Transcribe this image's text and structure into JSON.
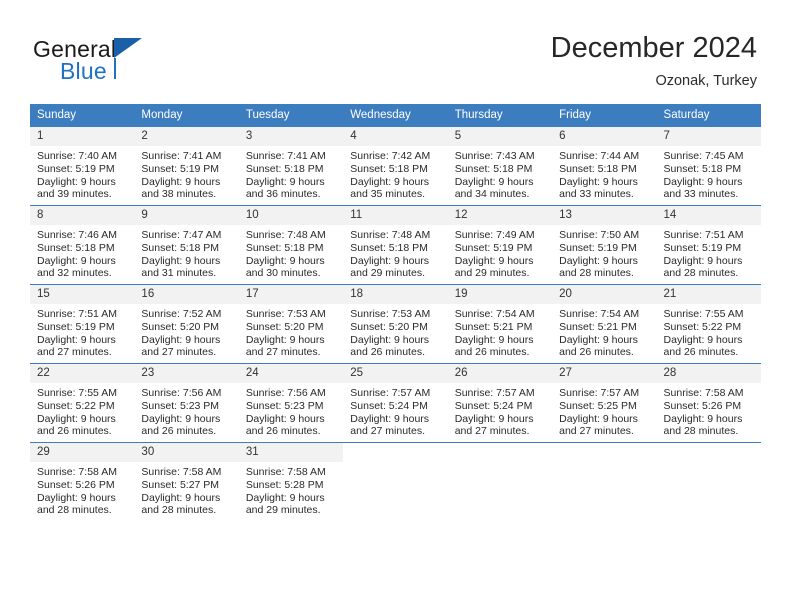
{
  "brand": {
    "name_part1": "General",
    "name_part2": "Blue",
    "triangle_color": "#1a5fa8",
    "blue_color": "#1f72c2"
  },
  "header": {
    "title": "December 2024",
    "subtitle": "Ozonak, Turkey"
  },
  "theme": {
    "header_blue": "#3c7dc0",
    "daynum_gray": "#f2f2f2",
    "text": "#2a2a2a"
  },
  "weekday_headers": [
    "Sunday",
    "Monday",
    "Tuesday",
    "Wednesday",
    "Thursday",
    "Friday",
    "Saturday"
  ],
  "weeks": [
    [
      {
        "day": "1",
        "sunrise": "Sunrise: 7:40 AM",
        "sunset": "Sunset: 5:19 PM",
        "daylight1": "Daylight: 9 hours",
        "daylight2": "and 39 minutes."
      },
      {
        "day": "2",
        "sunrise": "Sunrise: 7:41 AM",
        "sunset": "Sunset: 5:19 PM",
        "daylight1": "Daylight: 9 hours",
        "daylight2": "and 38 minutes."
      },
      {
        "day": "3",
        "sunrise": "Sunrise: 7:41 AM",
        "sunset": "Sunset: 5:18 PM",
        "daylight1": "Daylight: 9 hours",
        "daylight2": "and 36 minutes."
      },
      {
        "day": "4",
        "sunrise": "Sunrise: 7:42 AM",
        "sunset": "Sunset: 5:18 PM",
        "daylight1": "Daylight: 9 hours",
        "daylight2": "and 35 minutes."
      },
      {
        "day": "5",
        "sunrise": "Sunrise: 7:43 AM",
        "sunset": "Sunset: 5:18 PM",
        "daylight1": "Daylight: 9 hours",
        "daylight2": "and 34 minutes."
      },
      {
        "day": "6",
        "sunrise": "Sunrise: 7:44 AM",
        "sunset": "Sunset: 5:18 PM",
        "daylight1": "Daylight: 9 hours",
        "daylight2": "and 33 minutes."
      },
      {
        "day": "7",
        "sunrise": "Sunrise: 7:45 AM",
        "sunset": "Sunset: 5:18 PM",
        "daylight1": "Daylight: 9 hours",
        "daylight2": "and 33 minutes."
      }
    ],
    [
      {
        "day": "8",
        "sunrise": "Sunrise: 7:46 AM",
        "sunset": "Sunset: 5:18 PM",
        "daylight1": "Daylight: 9 hours",
        "daylight2": "and 32 minutes."
      },
      {
        "day": "9",
        "sunrise": "Sunrise: 7:47 AM",
        "sunset": "Sunset: 5:18 PM",
        "daylight1": "Daylight: 9 hours",
        "daylight2": "and 31 minutes."
      },
      {
        "day": "10",
        "sunrise": "Sunrise: 7:48 AM",
        "sunset": "Sunset: 5:18 PM",
        "daylight1": "Daylight: 9 hours",
        "daylight2": "and 30 minutes."
      },
      {
        "day": "11",
        "sunrise": "Sunrise: 7:48 AM",
        "sunset": "Sunset: 5:18 PM",
        "daylight1": "Daylight: 9 hours",
        "daylight2": "and 29 minutes."
      },
      {
        "day": "12",
        "sunrise": "Sunrise: 7:49 AM",
        "sunset": "Sunset: 5:19 PM",
        "daylight1": "Daylight: 9 hours",
        "daylight2": "and 29 minutes."
      },
      {
        "day": "13",
        "sunrise": "Sunrise: 7:50 AM",
        "sunset": "Sunset: 5:19 PM",
        "daylight1": "Daylight: 9 hours",
        "daylight2": "and 28 minutes."
      },
      {
        "day": "14",
        "sunrise": "Sunrise: 7:51 AM",
        "sunset": "Sunset: 5:19 PM",
        "daylight1": "Daylight: 9 hours",
        "daylight2": "and 28 minutes."
      }
    ],
    [
      {
        "day": "15",
        "sunrise": "Sunrise: 7:51 AM",
        "sunset": "Sunset: 5:19 PM",
        "daylight1": "Daylight: 9 hours",
        "daylight2": "and 27 minutes."
      },
      {
        "day": "16",
        "sunrise": "Sunrise: 7:52 AM",
        "sunset": "Sunset: 5:20 PM",
        "daylight1": "Daylight: 9 hours",
        "daylight2": "and 27 minutes."
      },
      {
        "day": "17",
        "sunrise": "Sunrise: 7:53 AM",
        "sunset": "Sunset: 5:20 PM",
        "daylight1": "Daylight: 9 hours",
        "daylight2": "and 27 minutes."
      },
      {
        "day": "18",
        "sunrise": "Sunrise: 7:53 AM",
        "sunset": "Sunset: 5:20 PM",
        "daylight1": "Daylight: 9 hours",
        "daylight2": "and 26 minutes."
      },
      {
        "day": "19",
        "sunrise": "Sunrise: 7:54 AM",
        "sunset": "Sunset: 5:21 PM",
        "daylight1": "Daylight: 9 hours",
        "daylight2": "and 26 minutes."
      },
      {
        "day": "20",
        "sunrise": "Sunrise: 7:54 AM",
        "sunset": "Sunset: 5:21 PM",
        "daylight1": "Daylight: 9 hours",
        "daylight2": "and 26 minutes."
      },
      {
        "day": "21",
        "sunrise": "Sunrise: 7:55 AM",
        "sunset": "Sunset: 5:22 PM",
        "daylight1": "Daylight: 9 hours",
        "daylight2": "and 26 minutes."
      }
    ],
    [
      {
        "day": "22",
        "sunrise": "Sunrise: 7:55 AM",
        "sunset": "Sunset: 5:22 PM",
        "daylight1": "Daylight: 9 hours",
        "daylight2": "and 26 minutes."
      },
      {
        "day": "23",
        "sunrise": "Sunrise: 7:56 AM",
        "sunset": "Sunset: 5:23 PM",
        "daylight1": "Daylight: 9 hours",
        "daylight2": "and 26 minutes."
      },
      {
        "day": "24",
        "sunrise": "Sunrise: 7:56 AM",
        "sunset": "Sunset: 5:23 PM",
        "daylight1": "Daylight: 9 hours",
        "daylight2": "and 26 minutes."
      },
      {
        "day": "25",
        "sunrise": "Sunrise: 7:57 AM",
        "sunset": "Sunset: 5:24 PM",
        "daylight1": "Daylight: 9 hours",
        "daylight2": "and 27 minutes."
      },
      {
        "day": "26",
        "sunrise": "Sunrise: 7:57 AM",
        "sunset": "Sunset: 5:24 PM",
        "daylight1": "Daylight: 9 hours",
        "daylight2": "and 27 minutes."
      },
      {
        "day": "27",
        "sunrise": "Sunrise: 7:57 AM",
        "sunset": "Sunset: 5:25 PM",
        "daylight1": "Daylight: 9 hours",
        "daylight2": "and 27 minutes."
      },
      {
        "day": "28",
        "sunrise": "Sunrise: 7:58 AM",
        "sunset": "Sunset: 5:26 PM",
        "daylight1": "Daylight: 9 hours",
        "daylight2": "and 28 minutes."
      }
    ],
    [
      {
        "day": "29",
        "sunrise": "Sunrise: 7:58 AM",
        "sunset": "Sunset: 5:26 PM",
        "daylight1": "Daylight: 9 hours",
        "daylight2": "and 28 minutes."
      },
      {
        "day": "30",
        "sunrise": "Sunrise: 7:58 AM",
        "sunset": "Sunset: 5:27 PM",
        "daylight1": "Daylight: 9 hours",
        "daylight2": "and 28 minutes."
      },
      {
        "day": "31",
        "sunrise": "Sunrise: 7:58 AM",
        "sunset": "Sunset: 5:28 PM",
        "daylight1": "Daylight: 9 hours",
        "daylight2": "and 29 minutes."
      },
      {
        "day": "",
        "sunrise": "",
        "sunset": "",
        "daylight1": "",
        "daylight2": ""
      },
      {
        "day": "",
        "sunrise": "",
        "sunset": "",
        "daylight1": "",
        "daylight2": ""
      },
      {
        "day": "",
        "sunrise": "",
        "sunset": "",
        "daylight1": "",
        "daylight2": ""
      },
      {
        "day": "",
        "sunrise": "",
        "sunset": "",
        "daylight1": "",
        "daylight2": ""
      }
    ]
  ]
}
